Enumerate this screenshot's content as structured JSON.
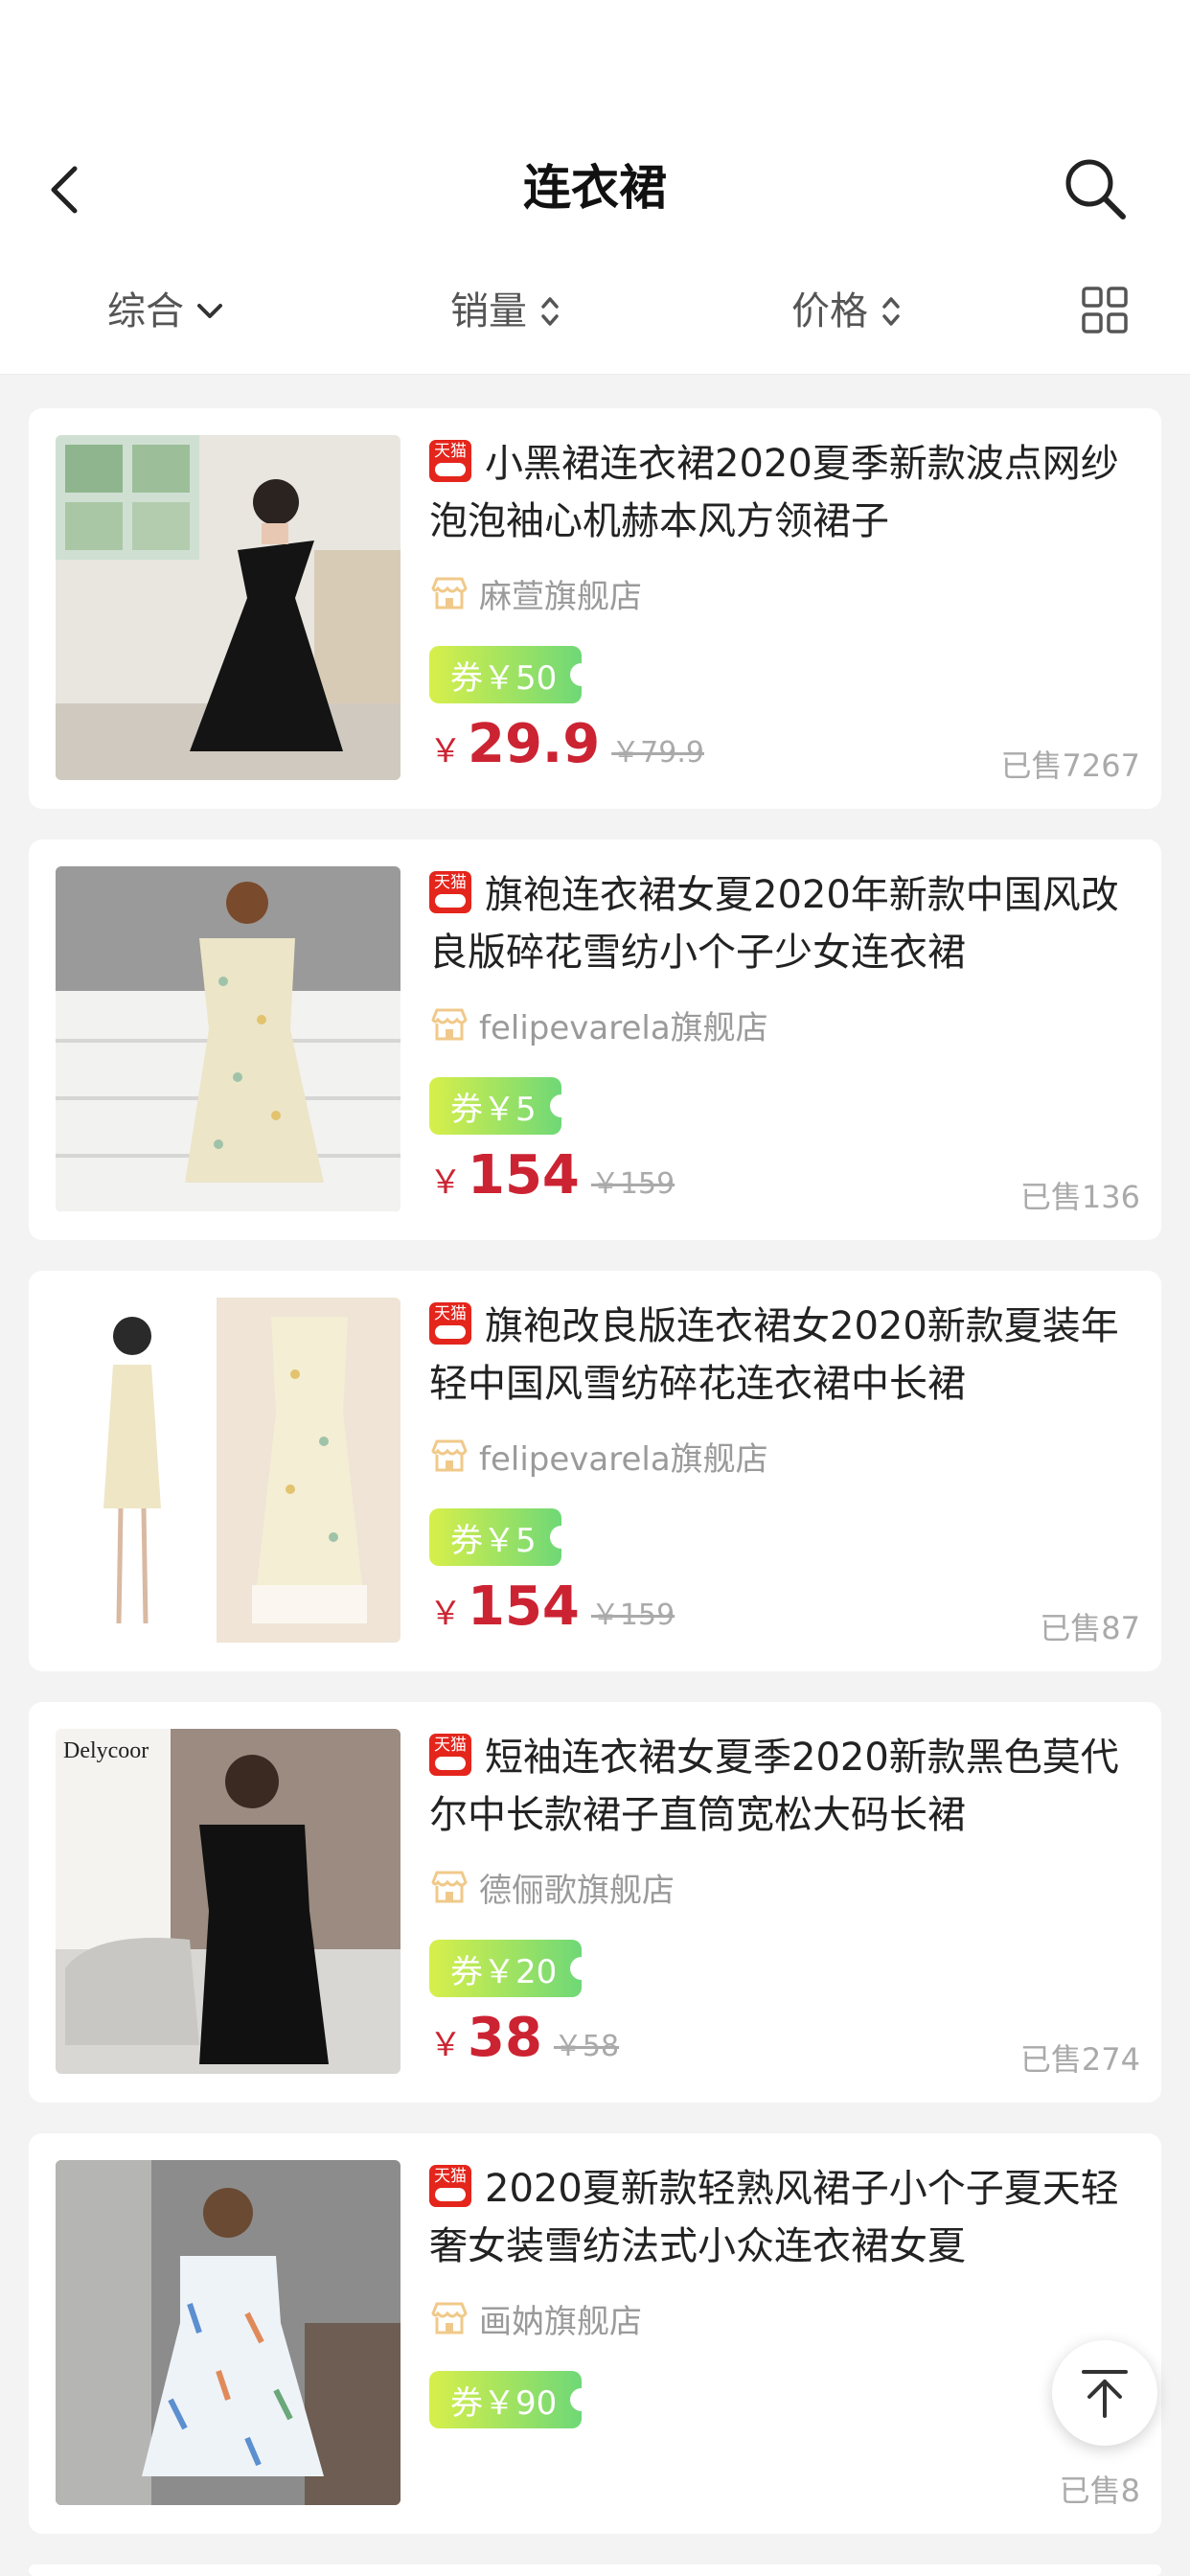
{
  "header": {
    "title": "连衣裙",
    "back_icon": "chevron-left-icon",
    "search_icon": "search-icon"
  },
  "filters": [
    {
      "label": "综合",
      "icon": "chevron-down-icon"
    },
    {
      "label": "销量",
      "icon": "sort-updown-icon"
    },
    {
      "label": "价格",
      "icon": "sort-updown-icon"
    }
  ],
  "layout_toggle_icon": "grid-icon",
  "products": [
    {
      "title": "小黑裙连衣裙2020夏季新款波点网纱泡泡袖心机赫本风方领裙子",
      "badge": "天猫",
      "shop": "麻萱旗舰店",
      "coupon": "券￥50",
      "currency": "￥",
      "price": "29.9",
      "original_price": "￥79.9",
      "sold": "已售7267"
    },
    {
      "title": "旗袍连衣裙女夏2020年新款中国风改良版碎花雪纺小个子少女连衣裙",
      "badge": "天猫",
      "shop": "felipevarela旗舰店",
      "coupon": "券￥5",
      "currency": "￥",
      "price": "154",
      "original_price": "￥159",
      "sold": "已售136"
    },
    {
      "title": "旗袍改良版连衣裙女2020新款夏装年轻中国风雪纺碎花连衣裙中长裙",
      "badge": "天猫",
      "shop": "felipevarela旗舰店",
      "coupon": "券￥5",
      "currency": "￥",
      "price": "154",
      "original_price": "￥159",
      "sold": "已售87"
    },
    {
      "title": "短袖连衣裙女夏季2020新款黑色莫代尔中长款裙子直筒宽松大码长裙",
      "badge": "天猫",
      "shop": "德俪歌旗舰店",
      "coupon": "券￥20",
      "currency": "￥",
      "price": "38",
      "original_price": "￥58",
      "sold": "已售274",
      "image_text": "Delycoor"
    },
    {
      "title": "2020夏新款轻熟风裙子小个子夏天轻奢女装雪纺法式小众连衣裙女夏",
      "badge": "天猫",
      "shop": "画妠旗舰店",
      "coupon": "券￥90",
      "sold": "已售8"
    }
  ],
  "back_to_top_icon": "arrow-up-to-top-icon",
  "colors": {
    "price_red": "#cc2332",
    "tmall_red": "#e4251c",
    "coupon_start": "#d8ef4a",
    "coupon_end": "#6fd877"
  }
}
